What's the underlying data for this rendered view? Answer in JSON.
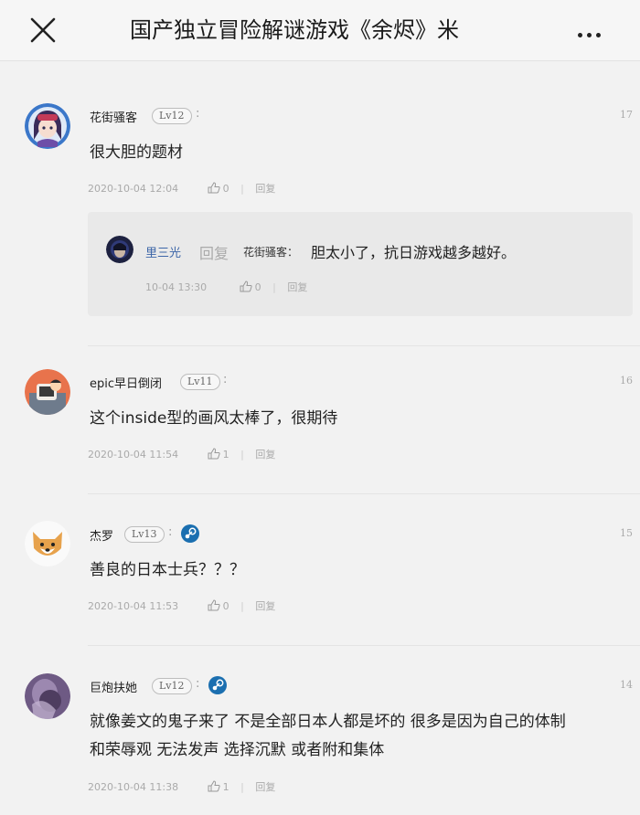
{
  "header": {
    "title": "国产独立冒险解谜游戏《余烬》米"
  },
  "comments": [
    {
      "username": "花街骚客",
      "level": "Lv12",
      "floor": "17",
      "text": "很大胆的题材",
      "time": "2020-10-04 12:04",
      "likes": "0",
      "reply_label": "回复",
      "has_steam": false,
      "avatar_icon": "anime-girl-avatar",
      "replies": [
        {
          "username": "里三光",
          "reply_label": "回复",
          "target": "花街骚客：",
          "text": "胆太小了，抗日游戏越多越好。",
          "time": "10-04 13:30",
          "likes": "0",
          "action": "回复"
        }
      ]
    },
    {
      "username": "epic早日倒闭",
      "level": "Lv11",
      "floor": "16",
      "text": "这个inside型的画风太棒了，很期待",
      "time": "2020-10-04 11:54",
      "likes": "1",
      "reply_label": "回复",
      "has_steam": false,
      "avatar_icon": "cartoon-avatar"
    },
    {
      "username": "杰罗",
      "level": "Lv13",
      "floor": "15",
      "text": "善良的日本士兵？？？",
      "time": "2020-10-04 11:53",
      "likes": "0",
      "reply_label": "回复",
      "has_steam": true,
      "avatar_icon": "shiba-dog-avatar"
    },
    {
      "username": "巨炮扶她",
      "level": "Lv12",
      "floor": "14",
      "text_line1": "就像姜文的鬼子来了 不是全部日本人都是坏的 很多是因为自己的体制",
      "text_line2": "和荣辱观 无法发声 选择沉默 或者附和集体",
      "time": "2020-10-04 11:38",
      "likes": "1",
      "reply_label": "回复",
      "has_steam": true,
      "avatar_icon": "purple-avatar"
    }
  ],
  "colors": {
    "background": "#f2f2f2",
    "reply_box": "#e9e9e9",
    "reply_name": "#3d66a8",
    "steam_badge": "#1b6fb0",
    "meta_gray": "#aaaaaa"
  }
}
